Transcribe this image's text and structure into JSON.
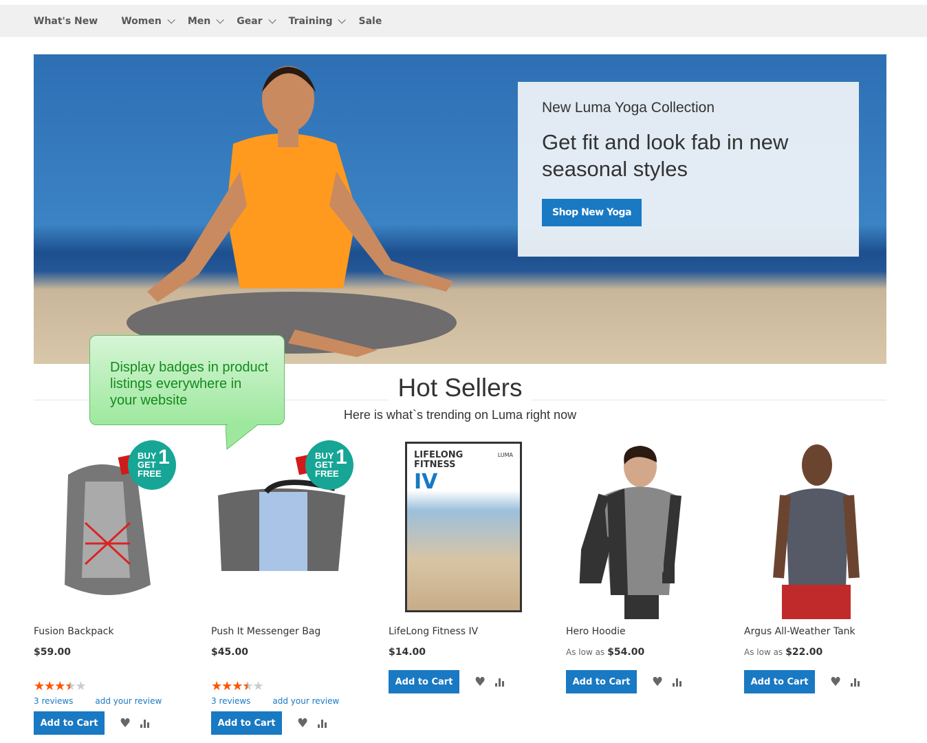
{
  "nav": {
    "items": [
      {
        "label": "What's New",
        "dropdown": false
      },
      {
        "label": "Women",
        "dropdown": true
      },
      {
        "label": "Men",
        "dropdown": true
      },
      {
        "label": "Gear",
        "dropdown": true
      },
      {
        "label": "Training",
        "dropdown": true
      },
      {
        "label": "Sale",
        "dropdown": false
      }
    ]
  },
  "hero": {
    "subtitle": "New Luma Yoga Collection",
    "title": "Get fit and look fab in new seasonal styles",
    "button": "Shop New Yoga"
  },
  "callout": {
    "text": "Display badges in product listings everywhere in your website"
  },
  "hot_sellers": {
    "title": "Hot Sellers",
    "subtitle": "Here is what`s trending on Luma right now"
  },
  "badge": {
    "text": [
      "BUY",
      "GET",
      "FREE",
      "1"
    ]
  },
  "products": [
    {
      "name": "Fusion Backpack",
      "price": "$59.00",
      "price_prefix": "",
      "rating_percent": 70,
      "reviews": "3  reviews",
      "add_review": "add your review",
      "button": "Add to Cart",
      "badge": true
    },
    {
      "name": "Push It Messenger Bag",
      "price": "$45.00",
      "price_prefix": "",
      "rating_percent": 70,
      "reviews": "3  reviews",
      "add_review": "add your review",
      "button": "Add to Cart",
      "badge": true
    },
    {
      "name": "LifeLong Fitness IV",
      "price": "$14.00",
      "price_prefix": "",
      "button": "Add to Cart",
      "dvd": {
        "title": "LIFELONG FITNESS",
        "numeral": "IV",
        "brand": "LUMA"
      }
    },
    {
      "name": "Hero Hoodie",
      "price": "$54.00",
      "price_prefix": "As low as",
      "button": "Add to Cart"
    },
    {
      "name": "Argus All-Weather Tank",
      "price": "$22.00",
      "price_prefix": "As low as",
      "button": "Add to Cart"
    }
  ],
  "colors": {
    "accent": "#1979c3",
    "star": "#ff5501",
    "nav_bg": "#f0f0f0",
    "callout_text": "#138a1c"
  }
}
